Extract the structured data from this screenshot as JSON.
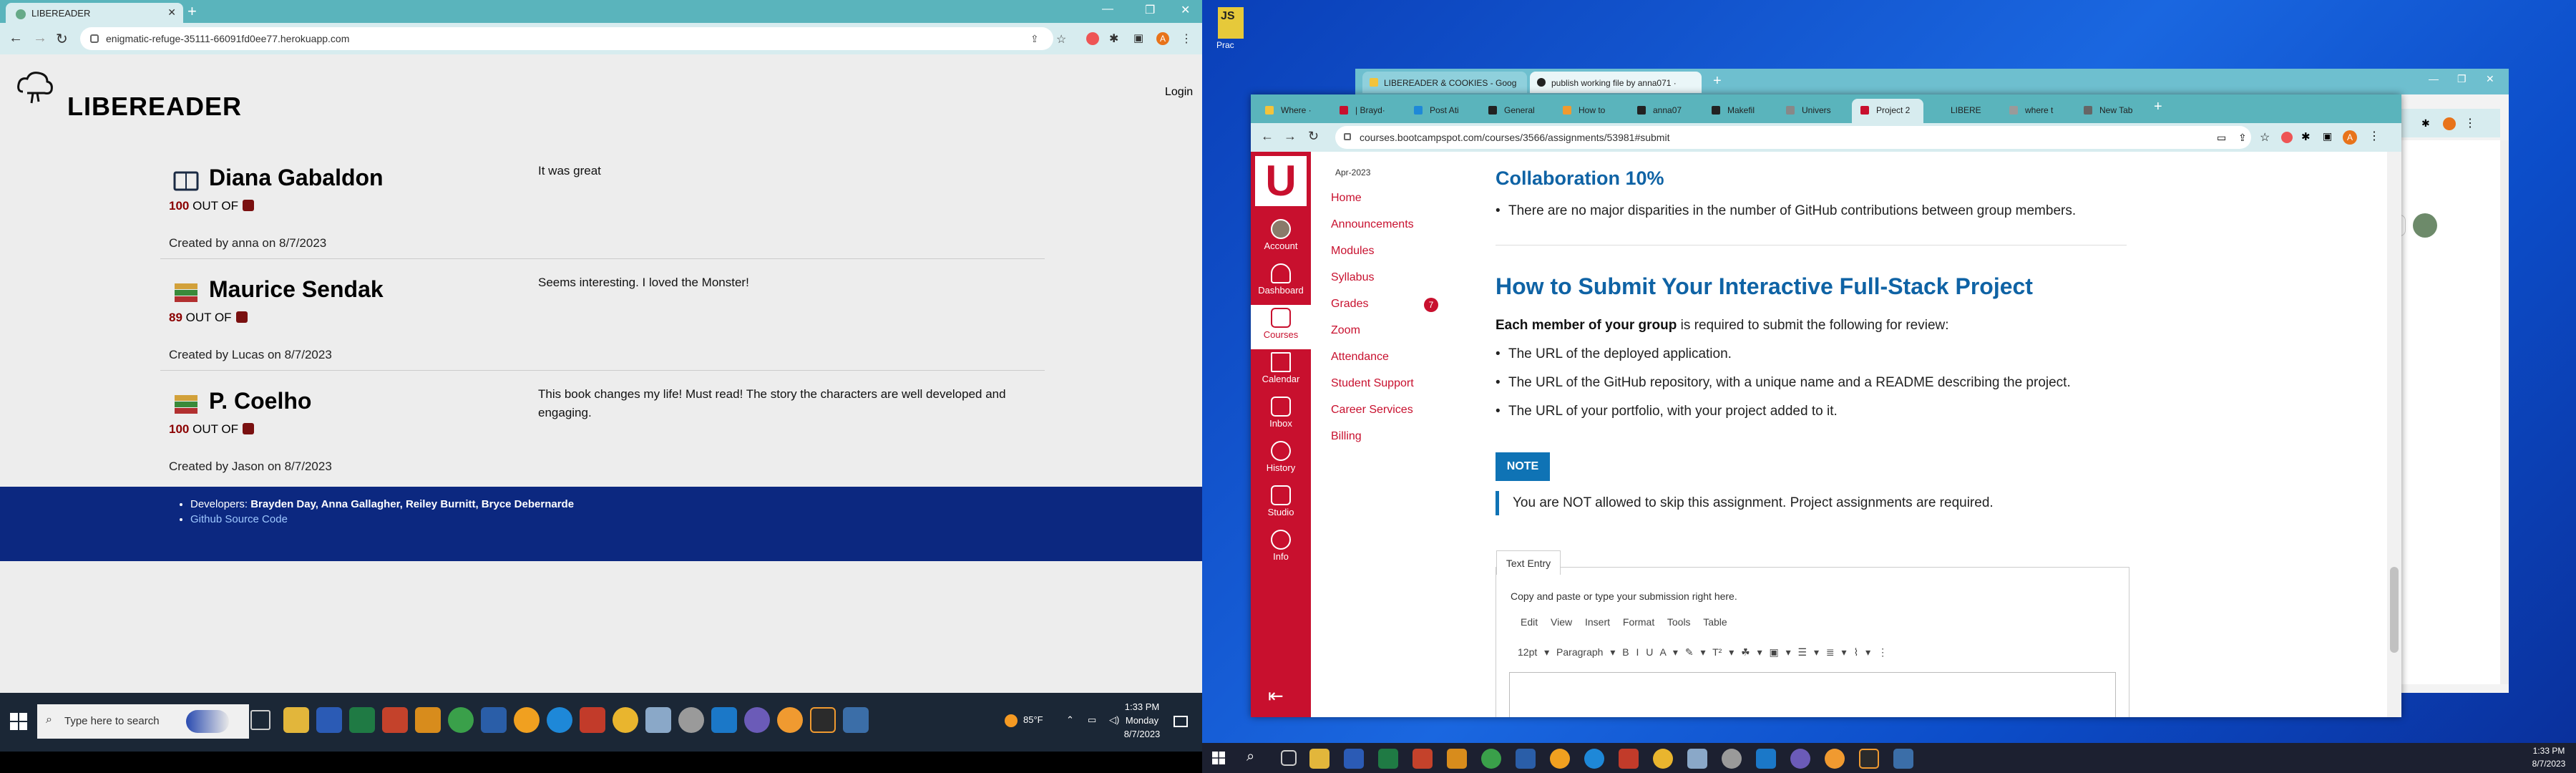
{
  "left_browser": {
    "tab_title": "LIBEREADER",
    "url": "enigmatic-refuge-35111-66091fd0ee77.herokuapp.com",
    "profile_initial": "A"
  },
  "app": {
    "brand": "LIBEREADER",
    "login_label": "Login",
    "entries": [
      {
        "author": "Diana Gabaldon",
        "score": "100",
        "out_of": "OUT OF",
        "created": "Created by anna on 8/7/2023",
        "review": "It was great"
      },
      {
        "author": "Maurice Sendak",
        "score": "89",
        "out_of": "OUT OF",
        "created": "Created by Lucas on 8/7/2023",
        "review": "Seems interesting. I loved the Monster!"
      },
      {
        "author": "P. Coelho",
        "score": "100",
        "out_of": "OUT OF",
        "created": "Created by Jason on 8/7/2023",
        "review": "This book changes my life! Must read! The story the characters are well developed and engaging."
      }
    ],
    "footer": {
      "developers_label": "Developers:",
      "developers": "Brayden Day, Anna Gallagher, Reiley Burnitt, Bryce Debernarde",
      "github_link": "Github Source Code"
    }
  },
  "taskbar_left": {
    "search_placeholder": "Type here to search",
    "weather": "85°F",
    "time": "1:33 PM",
    "day": "Monday",
    "date": "8/7/2023"
  },
  "desktop": {
    "icon_label": "Prac",
    "icon_text": "JS"
  },
  "back_window": {
    "tabs": [
      "LIBEREADER & COOKIES - Goog",
      "publish working file by anna071 ·"
    ]
  },
  "front_window": {
    "tabs": [
      "Where ·",
      "| Brayd·",
      "Post Ati",
      "General",
      "How to",
      "anna07",
      "Makefil",
      "Univers",
      "Project 2",
      "LIBERE",
      "where t",
      "New Tab"
    ],
    "active_tab_index": 8,
    "url": "courses.bootcampspot.com/courses/3566/assignments/53981#submit",
    "profile_initial": "A"
  },
  "canvas_nav": {
    "logo": "U",
    "items": [
      "Account",
      "Dashboard",
      "Courses",
      "Calendar",
      "Inbox",
      "History",
      "Studio",
      "Info"
    ],
    "active_item": "Courses"
  },
  "course_nav": {
    "date": "Apr-2023",
    "links": [
      "Home",
      "Announcements",
      "Modules",
      "Syllabus",
      "Grades",
      "Zoom",
      "Attendance",
      "Student Support",
      "Career Services",
      "Billing"
    ],
    "grades_badge": "7"
  },
  "assignment": {
    "collab_heading": "Collaboration 10%",
    "collab_bullet": "There are no major disparities in the number of GitHub contributions between group members.",
    "submit_heading": "How to Submit Your Interactive Full-Stack Project",
    "submit_intro_bold": "Each member of your group",
    "submit_intro_rest": " is required to submit the following for review:",
    "submit_items": [
      "The URL of the deployed application.",
      "The URL of the GitHub repository, with a unique name and a README describing the project.",
      "The URL of your portfolio, with your project added to it."
    ],
    "note_label": "NOTE",
    "note_text": "You are NOT allowed to skip this assignment. Project assignments are required.",
    "submission": {
      "tab_label": "Text Entry",
      "hint": "Copy and paste or type your submission right here.",
      "menu": "Edit View Insert Format Tools Table",
      "toolbar": "12pt ▾   Paragraph ▾   B  I  U  A ▾  ✎ ▾  T² ▾   ☘ ▾  ▣ ▾  ☰ ▾  ≣ ▾  ⌇ ▾   ⋮"
    }
  },
  "taskbar_right": {
    "time": "1:33 PM",
    "date": "8/7/2023"
  }
}
